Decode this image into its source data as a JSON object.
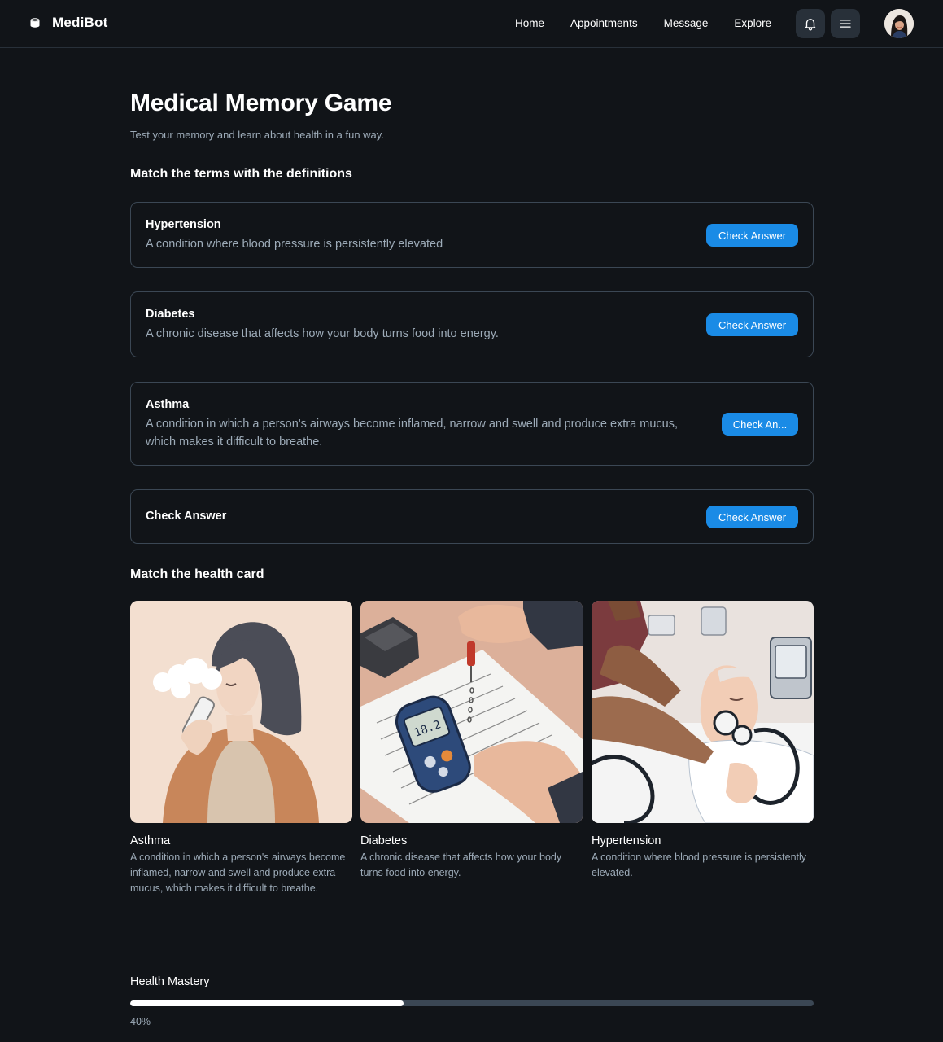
{
  "header": {
    "brand": "MediBot",
    "nav": [
      "Home",
      "Appointments",
      "Message",
      "Explore"
    ],
    "icons": {
      "brand": "logo-icon",
      "notifications": "bell-icon",
      "menu": "hamburger-menu-icon",
      "profile": "user-avatar"
    }
  },
  "main": {
    "title": "Medical Memory Game",
    "subtitle": "Test your memory and learn about health in a fun way.",
    "terms_section": {
      "heading": "Match the terms with the definitions",
      "items": [
        {
          "term": "Hypertension",
          "definition": "A condition where blood pressure is persistently elevated",
          "button": "Check Answer"
        },
        {
          "term": "Diabetes",
          "definition": "A chronic disease that affects how your body turns food into energy.",
          "button": "Check Answer"
        },
        {
          "term": "Asthma",
          "definition": "A condition in which a person's airways become inflamed, narrow and swell and produce extra mucus, which makes it difficult to breathe.",
          "button": "Check An..."
        },
        {
          "term": "Check Answer",
          "button": "Check Answer"
        }
      ]
    },
    "cards_section": {
      "heading": "Match the health card",
      "cards": [
        {
          "title": "Asthma",
          "description": "A condition in which a person's airways become inflamed, narrow and swell and produce extra mucus, which makes it difficult to breathe.",
          "image": "woman-using-inhaler-illustration"
        },
        {
          "title": "Diabetes",
          "description": "A chronic disease that affects how your body turns food into energy.",
          "image": "glucose-meter-blood-test-illustration"
        },
        {
          "title": "Hypertension",
          "description": "A condition where blood pressure is persistently elevated.",
          "image": "blood-pressure-measurement-illustration"
        }
      ]
    },
    "mastery": {
      "label": "Health Mastery",
      "percent_text": "40%",
      "value": 0.4
    }
  },
  "colors": {
    "background": "#111418",
    "border": "#3b4754",
    "accent": "#1a8be6",
    "muted_text": "#9dabb8",
    "progress_track": "#3b4754",
    "progress_fill": "#ffffff"
  }
}
